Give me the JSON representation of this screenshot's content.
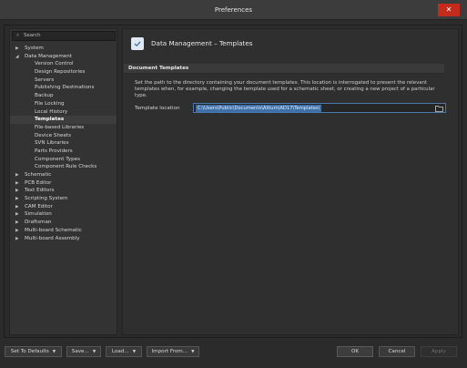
{
  "window": {
    "title": "Preferences",
    "close_label": "✕"
  },
  "search": {
    "placeholder": "Search",
    "icon": "search-icon"
  },
  "tree": [
    {
      "label": "System",
      "level": 0,
      "expanded": false
    },
    {
      "label": "Data Management",
      "level": 0,
      "expanded": true
    },
    {
      "label": "Version Control",
      "level": 1
    },
    {
      "label": "Design Repositories",
      "level": 1
    },
    {
      "label": "Servers",
      "level": 1
    },
    {
      "label": "Publishing Destinations",
      "level": 1
    },
    {
      "label": "Backup",
      "level": 1
    },
    {
      "label": "File Locking",
      "level": 1
    },
    {
      "label": "Local History",
      "level": 1
    },
    {
      "label": "Templates",
      "level": 1,
      "selected": true
    },
    {
      "label": "File-based Libraries",
      "level": 1
    },
    {
      "label": "Device Sheets",
      "level": 1
    },
    {
      "label": "SVN Libraries",
      "level": 1
    },
    {
      "label": "Parts Providers",
      "level": 1
    },
    {
      "label": "Component Types",
      "level": 1
    },
    {
      "label": "Component Rule Checks",
      "level": 1
    },
    {
      "label": "Schematic",
      "level": 0,
      "expanded": false
    },
    {
      "label": "PCB Editor",
      "level": 0,
      "expanded": false
    },
    {
      "label": "Text Editors",
      "level": 0,
      "expanded": false
    },
    {
      "label": "Scripting System",
      "level": 0,
      "expanded": false
    },
    {
      "label": "CAM Editor",
      "level": 0,
      "expanded": false
    },
    {
      "label": "Simulation",
      "level": 0,
      "expanded": false
    },
    {
      "label": "Draftsman",
      "level": 0,
      "expanded": false
    },
    {
      "label": "Multi-board Schematic",
      "level": 0,
      "expanded": false
    },
    {
      "label": "Multi-board Assembly",
      "level": 0,
      "expanded": false
    }
  ],
  "page": {
    "title": "Data Management – Templates",
    "section": "Document Templates",
    "description": "Set the path to the directory containing your document templates. This location is interrogated to present the relevant templates when, for example, changing the template used for a schematic sheet, or creating a new project of a particular type.",
    "location_label": "Template location",
    "location_value": "C:\\Users\\Public\\Documents\\Altium\\AD17\\Templates\\"
  },
  "buttons": {
    "set_to_defaults": "Set To Defaults",
    "save": "Save...",
    "load": "Load...",
    "import_from": "Import From...",
    "ok": "OK",
    "cancel": "Cancel",
    "apply": "Apply"
  },
  "colors": {
    "selection": "#3d6fa8",
    "close": "#c42b1c",
    "background": "#2b2b2b"
  }
}
